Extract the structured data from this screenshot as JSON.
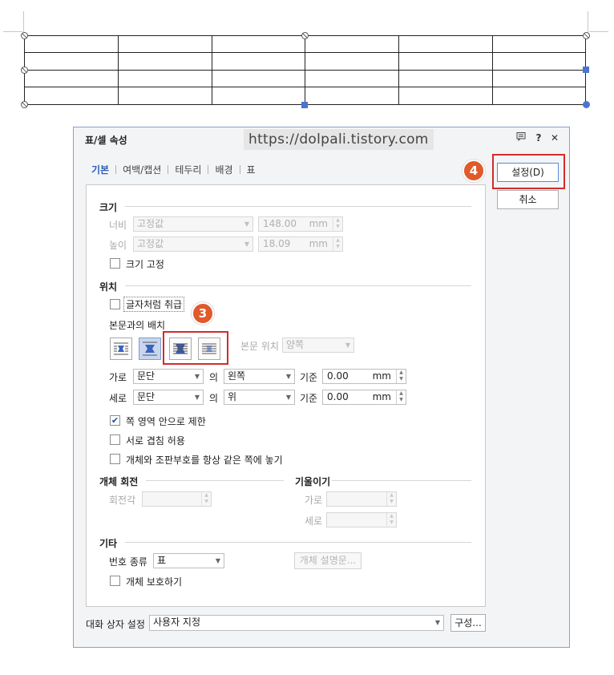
{
  "dialog": {
    "title": "표/셀 속성",
    "watermark": "https://dolpali.tistory.com",
    "help_icon": "?",
    "close_icon": "✕",
    "comment_icon": "comment-icon"
  },
  "tabs": [
    "기본",
    "여백/캡션",
    "테두리",
    "배경",
    "표"
  ],
  "buttons": {
    "ok": "설정(D)",
    "cancel": "취소",
    "obj_desc": "개체 설명문...",
    "configure": "구성..."
  },
  "size": {
    "section": "크기",
    "width_label": "너비",
    "width_mode": "고정값",
    "width_value": "148.00",
    "width_unit": "mm",
    "height_label": "높이",
    "height_mode": "고정값",
    "height_value": "18.09",
    "height_unit": "mm",
    "fix_label": "크기 고정"
  },
  "position": {
    "section": "위치",
    "as_char_label": "글자처럼 취급",
    "wrap_label": "본문과의 배치",
    "body_pos_label": "본문 위치",
    "body_pos_value": "양쪽",
    "horiz_label": "가로",
    "horiz_ref": "문단",
    "of1": "의",
    "horiz_align": "왼쪽",
    "basis1": "기준",
    "horiz_value": "0.00",
    "horiz_unit": "mm",
    "vert_label": "세로",
    "vert_ref": "문단",
    "of2": "의",
    "vert_align": "위",
    "basis2": "기준",
    "vert_value": "0.00",
    "vert_unit": "mm",
    "limit_label": "쪽 영역 안으로 제한",
    "overlap_label": "서로 겹침 허용",
    "same_page_label": "개체와 조판부호를 항상 같은 쪽에 놓기"
  },
  "rotate": {
    "section": "개체 회전",
    "angle_label": "회전각"
  },
  "skew": {
    "section": "기울이기",
    "h_label": "가로",
    "v_label": "세로"
  },
  "etc": {
    "section": "기타",
    "num_type_label": "번호 종류",
    "num_type_value": "표",
    "protect_label": "개체 보호하기"
  },
  "footer": {
    "label": "대화 상자 설정",
    "value": "사용자 지정"
  },
  "badges": {
    "three": "3",
    "four": "4"
  },
  "checked": {
    "size_fix": false,
    "as_char": false,
    "limit": true,
    "overlap": false,
    "same_page": false,
    "protect": false
  },
  "colors": {
    "accent": "#2b5fb5",
    "highlight": "#d32b2b",
    "badge": "#e05a2b",
    "handle": "#4a74d4"
  }
}
